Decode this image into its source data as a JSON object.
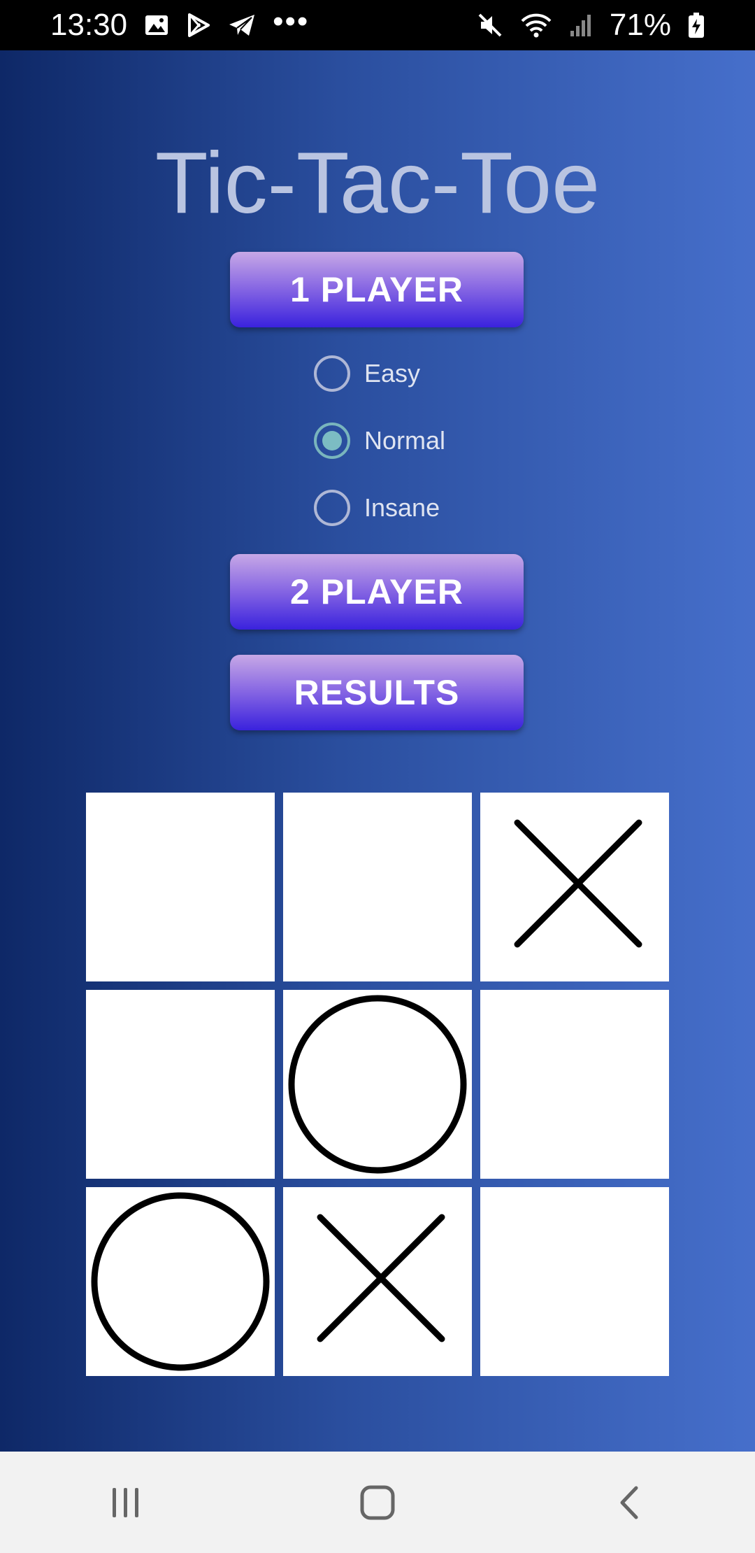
{
  "status_bar": {
    "time": "13:30",
    "battery_percent": "71%",
    "left_icons": [
      "gallery-icon",
      "play-store-icon",
      "telegram-icon",
      "more-notifications-icon"
    ],
    "right_icons": [
      "mute-icon",
      "wifi-icon",
      "signal-icon",
      "battery-charging-icon"
    ],
    "more_dots": "•••"
  },
  "app": {
    "title": "Tic-Tac-Toe",
    "buttons": {
      "one_player": "1 PLAYER",
      "two_player": "2 PLAYER",
      "results": "RESULTS"
    },
    "difficulty": {
      "options": [
        "Easy",
        "Normal",
        "Insane"
      ],
      "selected": "Normal"
    },
    "board": [
      [
        "",
        "",
        "X"
      ],
      [
        "",
        "O",
        ""
      ],
      [
        "O",
        "X",
        ""
      ]
    ]
  },
  "nav_bar": {
    "buttons": [
      "recent-apps-icon",
      "home-icon",
      "back-icon"
    ]
  },
  "colors": {
    "accent_radio": "#7cbcc3",
    "button_gradient_top": "#c7a8e6",
    "button_gradient_bottom": "#3a22dd"
  }
}
